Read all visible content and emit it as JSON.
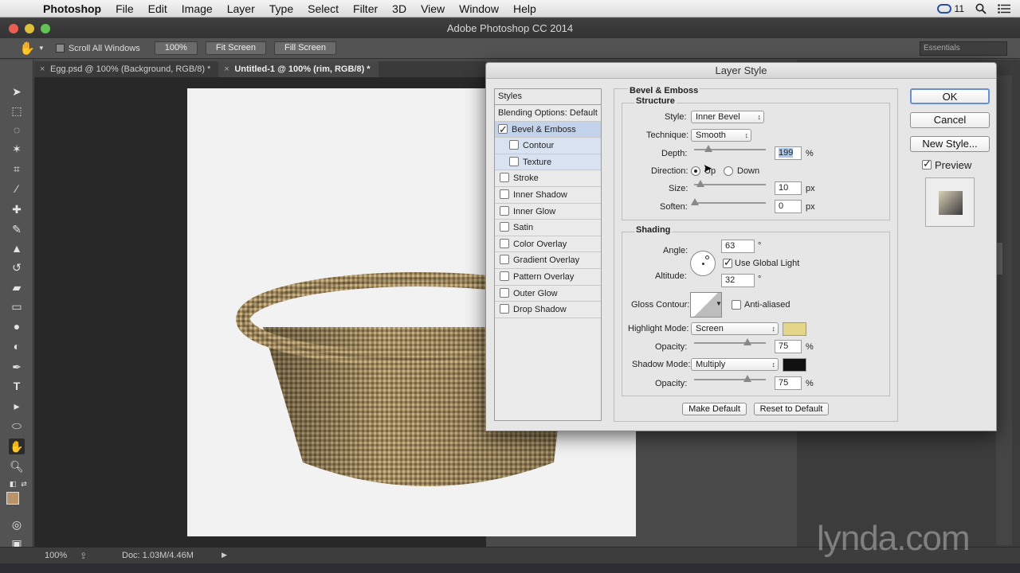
{
  "menubar": {
    "app": "Photoshop",
    "items": [
      "File",
      "Edit",
      "Image",
      "Layer",
      "Type",
      "Select",
      "Filter",
      "3D",
      "View",
      "Window",
      "Help"
    ],
    "cc_count": "11"
  },
  "window": {
    "title": "Adobe Photoshop CC 2014"
  },
  "options": {
    "scroll_all": "Scroll All Windows",
    "zoom_btn": "100%",
    "fit_btn": "Fit Screen",
    "fill_btn": "Fill Screen",
    "workspace": "Essentials"
  },
  "tabs": [
    {
      "label": "Egg.psd @ 100% (Background, RGB/8) *"
    },
    {
      "label": "Untitled-1 @ 100% (rim, RGB/8) *"
    }
  ],
  "status": {
    "zoom": "100%",
    "doc": "Doc: 1.03M/4.46M"
  },
  "watermark": "lynda.com",
  "dialog": {
    "title": "Layer Style",
    "styles_header": "Styles",
    "blending": "Blending Options: Default",
    "items": [
      {
        "label": "Bevel & Emboss",
        "checked": true
      },
      {
        "label": "Contour",
        "checked": false
      },
      {
        "label": "Texture",
        "checked": false
      },
      {
        "label": "Stroke",
        "checked": false
      },
      {
        "label": "Inner Shadow",
        "checked": false
      },
      {
        "label": "Inner Glow",
        "checked": false
      },
      {
        "label": "Satin",
        "checked": false
      },
      {
        "label": "Color Overlay",
        "checked": false
      },
      {
        "label": "Gradient Overlay",
        "checked": false
      },
      {
        "label": "Pattern Overlay",
        "checked": false
      },
      {
        "label": "Outer Glow",
        "checked": false
      },
      {
        "label": "Drop Shadow",
        "checked": false
      }
    ],
    "bevel": {
      "heading": "Bevel & Emboss",
      "structure": "Structure",
      "style_label": "Style:",
      "style_value": "Inner Bevel",
      "technique_label": "Technique:",
      "technique_value": "Smooth",
      "depth_label": "Depth:",
      "depth_value": "199",
      "pct": "%",
      "direction_label": "Direction:",
      "up": "Up",
      "down": "Down",
      "size_label": "Size:",
      "size_value": "10",
      "px": "px",
      "soften_label": "Soften:",
      "soften_value": "0"
    },
    "shading": {
      "heading": "Shading",
      "angle_label": "Angle:",
      "angle_value": "63",
      "deg": "°",
      "use_global": "Use Global Light",
      "altitude_label": "Altitude:",
      "altitude_value": "32",
      "gloss_label": "Gloss Contour:",
      "antialiased": "Anti-aliased",
      "highlight_label": "Highlight Mode:",
      "highlight_value": "Screen",
      "highlight_color": "#e3d68a",
      "opacity_label": "Opacity:",
      "highlight_opacity": "75",
      "shadow_label": "Shadow Mode:",
      "shadow_value": "Multiply",
      "shadow_color": "#111111",
      "shadow_opacity": "75"
    },
    "make_default": "Make Default",
    "reset_default": "Reset to Default",
    "ok": "OK",
    "cancel": "Cancel",
    "new_style": "New Style...",
    "preview": "Preview"
  }
}
